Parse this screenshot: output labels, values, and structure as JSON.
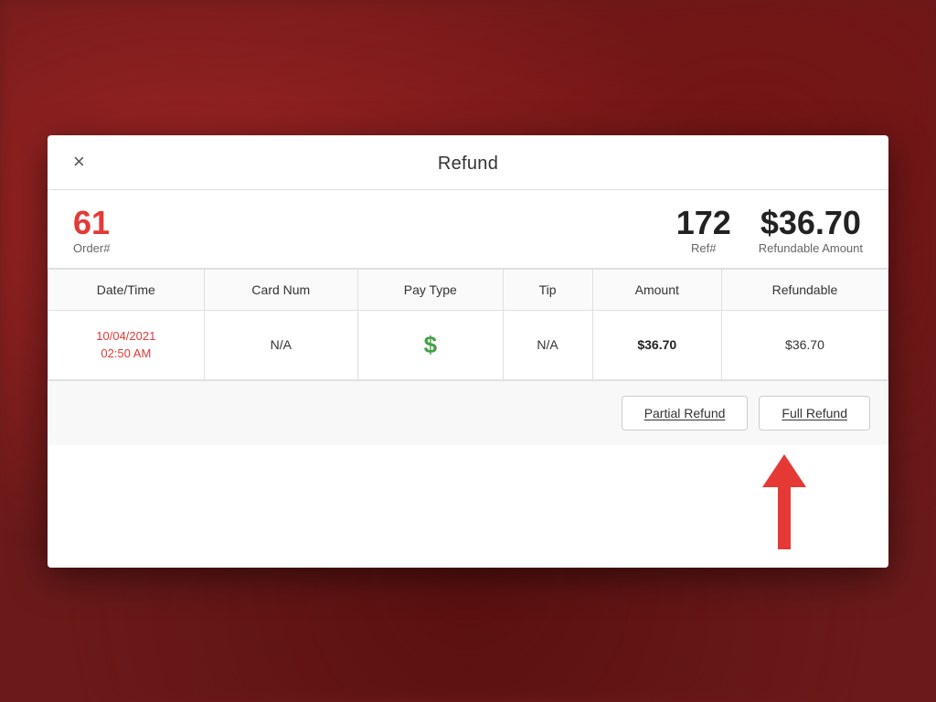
{
  "background": {
    "color": "#6b1a1a"
  },
  "modal": {
    "title": "Refund",
    "close_button_label": "×",
    "order": {
      "number": "61",
      "number_label": "Order#",
      "ref_number": "172",
      "ref_label": "Ref#",
      "refundable_amount": "$36.70",
      "refundable_label": "Refundable Amount"
    },
    "table": {
      "headers": [
        "Date/Time",
        "Card Num",
        "Pay Type",
        "Tip",
        "Amount",
        "Refundable"
      ],
      "rows": [
        {
          "date": "10/04/2021",
          "time": "02:50 AM",
          "card_num": "N/A",
          "pay_type_icon": "$",
          "tip": "N/A",
          "amount": "$36.70",
          "refundable": "$36.70"
        }
      ]
    },
    "buttons": {
      "partial_refund": "Partial Refund",
      "full_refund": "Full Refund"
    }
  }
}
